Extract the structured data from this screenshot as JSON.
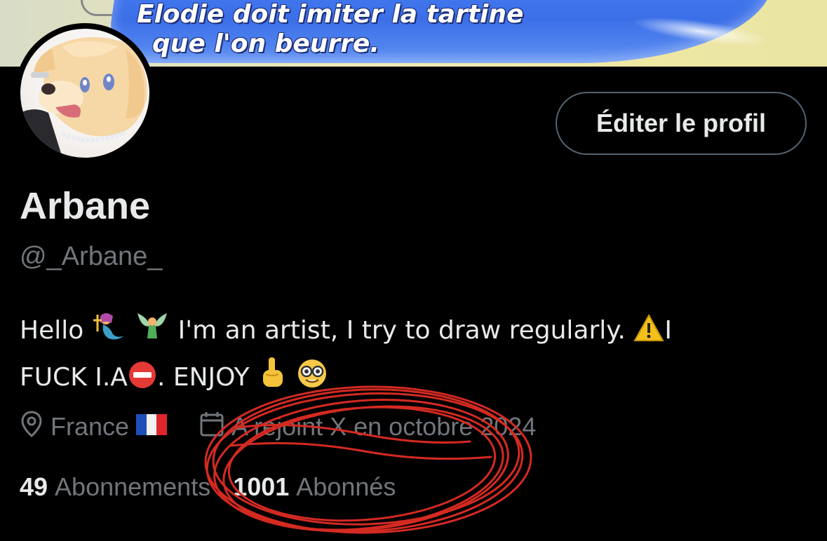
{
  "banner": {
    "caption_line1": "Elodie doit imiter la tartine",
    "caption_line2": "que l'on beurre."
  },
  "profile": {
    "edit_button_label": "Éditer le profil",
    "display_name": "Arbane",
    "handle": "@_Arbane_",
    "bio_part1": "Hello",
    "bio_part2": "I'm an artist, I try to draw regularly.",
    "bio_part3": "I",
    "bio_part4": "FUCK I.A",
    "bio_part5": ". ENJOY",
    "emojis": [
      "mermaid",
      "fairy",
      "warning",
      "no-entry",
      "point-up",
      "nerd-face"
    ],
    "location": "France",
    "location_flag": "france-flag",
    "joined": "A rejoint X en octobre 2024",
    "following_count": "49",
    "following_label": "Abonnements",
    "followers_count": "1001",
    "followers_label": "Abonnés"
  },
  "colors": {
    "background": "#000000",
    "text_primary": "#e7e9ea",
    "text_secondary": "#71767b",
    "button_border": "#536471",
    "annotation_red": "#d42a22",
    "banner_bubble": "#3b6fe8"
  }
}
